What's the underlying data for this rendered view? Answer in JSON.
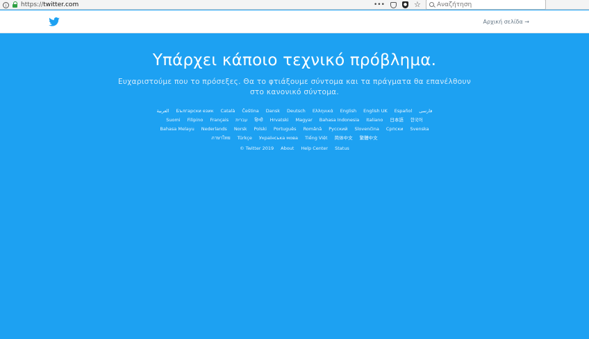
{
  "browser": {
    "url_prefix": "https://",
    "url_host": "twitter.com",
    "page_actions": "•••",
    "search_placeholder": "Αναζήτηση"
  },
  "nav": {
    "logo": "twitter-bird-icon",
    "home_link": "Αρχική σελίδα →",
    "brand_color": "#1da1f2"
  },
  "main": {
    "title": "Υπάρχει κάποιο τεχνικό πρόβλημα.",
    "subtitle": "Ευχαριστούμε που το πρόσεξες. Θα το φτιάξουμε σύντομα και τα πράγματα θα επανέλθουν στο κανονικό σύντομα."
  },
  "languages": {
    "row1": [
      "العربية",
      "Български език",
      "Català",
      "Čeština",
      "Dansk",
      "Deutsch",
      "Ελληνικά",
      "English",
      "English UK",
      "Español",
      "فارسی"
    ],
    "row2": [
      "Suomi",
      "Filipino",
      "Français",
      "עברית",
      "हिन्दी",
      "Hrvatski",
      "Magyar",
      "Bahasa Indonesia",
      "Italiano",
      "日本語",
      "한국어"
    ],
    "row3": [
      "Bahasa Melayu",
      "Nederlands",
      "Norsk",
      "Polski",
      "Português",
      "Română",
      "Русский",
      "Slovenčina",
      "Српски",
      "Svenska"
    ],
    "row4": [
      "ภาษาไทย",
      "Türkçe",
      "Українська мова",
      "Tiếng Việt",
      "简体中文",
      "繁體中文"
    ]
  },
  "footer": {
    "copyright": "© Twitter 2019",
    "about": "About",
    "help": "Help Center",
    "status": "Status"
  }
}
